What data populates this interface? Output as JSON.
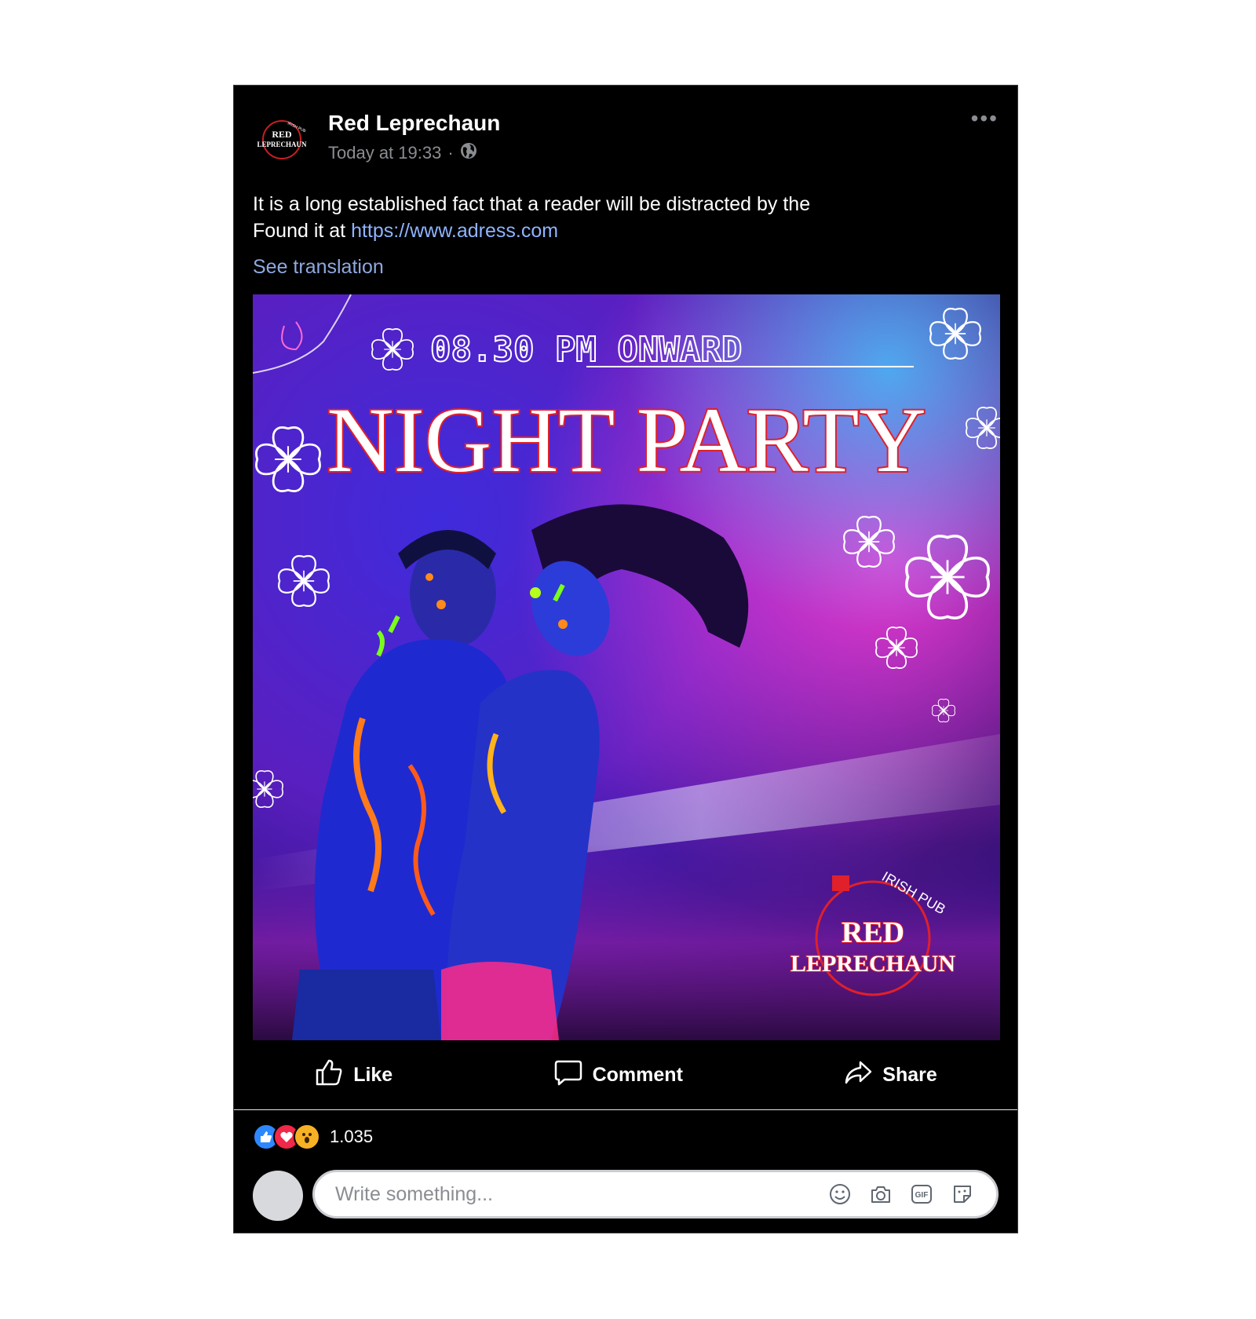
{
  "post": {
    "page_name": "Red Leprechaun",
    "timestamp": "Today at 19:33",
    "separator": "·",
    "audience_icon": "globe-icon",
    "more_icon": "ellipsis-icon",
    "more_label": "•••",
    "text_line1": "It is a long established fact that a reader will be distracted by the",
    "text_line2_prefix": "Found it at ",
    "link": "https://www.adress.com",
    "see_translation": "See translation"
  },
  "logo": {
    "line1": "RED",
    "line2": "LEPRECHAUN",
    "arc": "IRISH PUB"
  },
  "poster": {
    "time": "08.30 PM ONWARD",
    "title": "NIGHT PARTY",
    "brand_arc": "IRISH PUB",
    "brand_line1": "RED",
    "brand_line2": "LEPRECHAUN"
  },
  "actions": {
    "like": "Like",
    "comment": "Comment",
    "share": "Share"
  },
  "reactions": {
    "count": "1.035",
    "icons": [
      "like-reaction-icon",
      "love-reaction-icon",
      "wow-reaction-icon"
    ]
  },
  "composer": {
    "placeholder": "Write something...",
    "icons": [
      "emoji-icon",
      "camera-icon",
      "gif-icon",
      "sticker-icon"
    ],
    "gif_label": "GIF"
  },
  "colors": {
    "background": "#000000",
    "link": "#8fb4ff",
    "muted": "#8a8d91",
    "accent_red": "#e0202a",
    "like_blue": "#2d88ff"
  }
}
